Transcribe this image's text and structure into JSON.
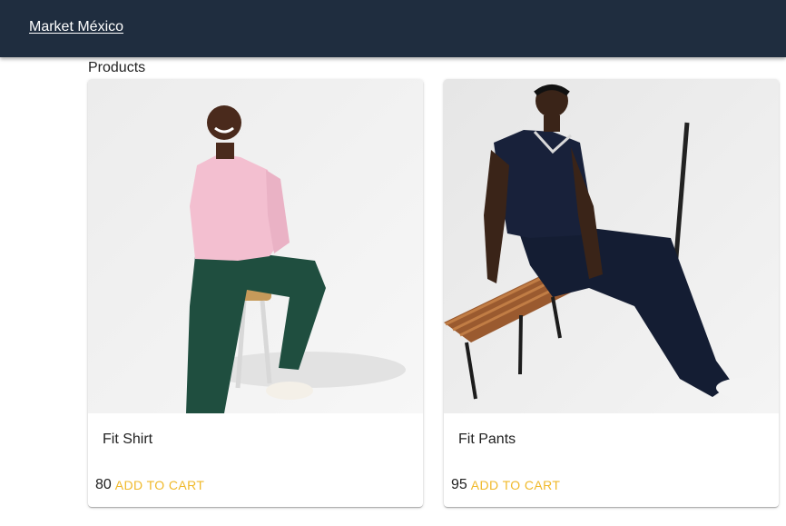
{
  "appbar": {
    "brand": "Market México",
    "background": "#1f2d3f"
  },
  "page": {
    "section_title": "Products"
  },
  "products": [
    {
      "title": "Fit Shirt",
      "price": "80",
      "action_label": "ADD TO CART",
      "image": "man-pink-shirt-on-stool-photo"
    },
    {
      "title": "Fit Pants",
      "price": "95",
      "action_label": "ADD TO CART",
      "image": "man-navy-polo-on-bench-photo"
    }
  ],
  "colors": {
    "accent": "#f0b92a",
    "text": "#212121"
  }
}
